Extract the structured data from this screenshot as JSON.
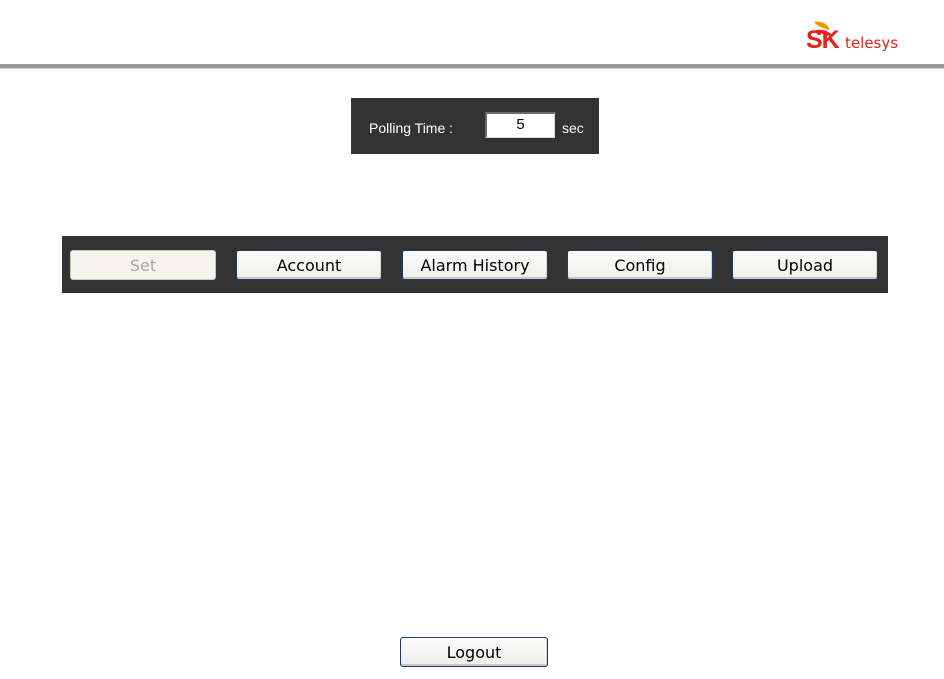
{
  "header": {
    "logo_brand": "SK",
    "logo_text": "telesys"
  },
  "polling": {
    "label": "Polling Time :",
    "value": "5",
    "unit": "sec"
  },
  "toolbar": {
    "buttons": [
      {
        "label": "Set",
        "enabled": false
      },
      {
        "label": "Account",
        "enabled": true
      },
      {
        "label": "Alarm History",
        "enabled": true
      },
      {
        "label": "Config",
        "enabled": true
      },
      {
        "label": "Upload",
        "enabled": true
      }
    ]
  },
  "footer": {
    "logout_label": "Logout"
  },
  "colors": {
    "brand_red": "#e2231a",
    "brand_orange": "#f39200",
    "panel_bg": "#333333",
    "divider": "#9a9a9a"
  }
}
